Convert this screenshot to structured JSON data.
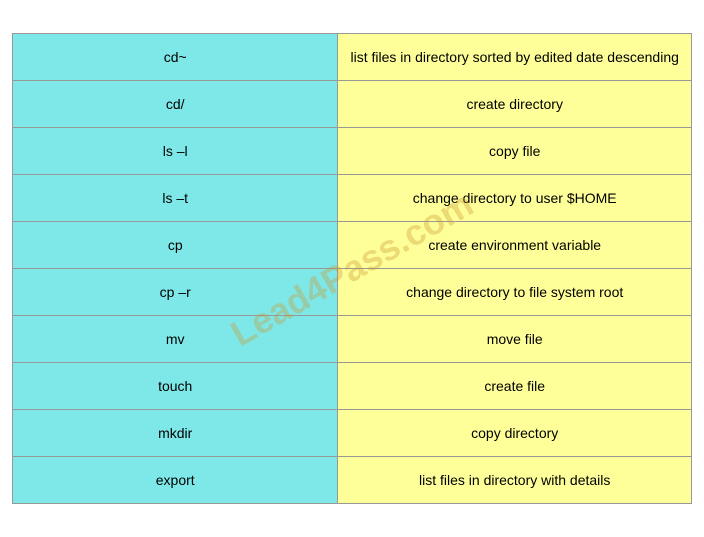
{
  "rows": [
    {
      "left": "cd~",
      "right": "list files in directory sorted by edited date descending"
    },
    {
      "left": "cd/",
      "right": "create directory"
    },
    {
      "left": "ls –l",
      "right": "copy file"
    },
    {
      "left": "ls –t",
      "right": "change directory to user $HOME"
    },
    {
      "left": "cp",
      "right": "create environment variable"
    },
    {
      "left": "cp –r",
      "right": "change directory to file system root"
    },
    {
      "left": "mv",
      "right": "move file"
    },
    {
      "left": "touch",
      "right": "create file"
    },
    {
      "left": "mkdir",
      "right": "copy directory"
    },
    {
      "left": "export",
      "right": "list files in directory with details"
    }
  ],
  "watermark": "Lead4Pass.com"
}
